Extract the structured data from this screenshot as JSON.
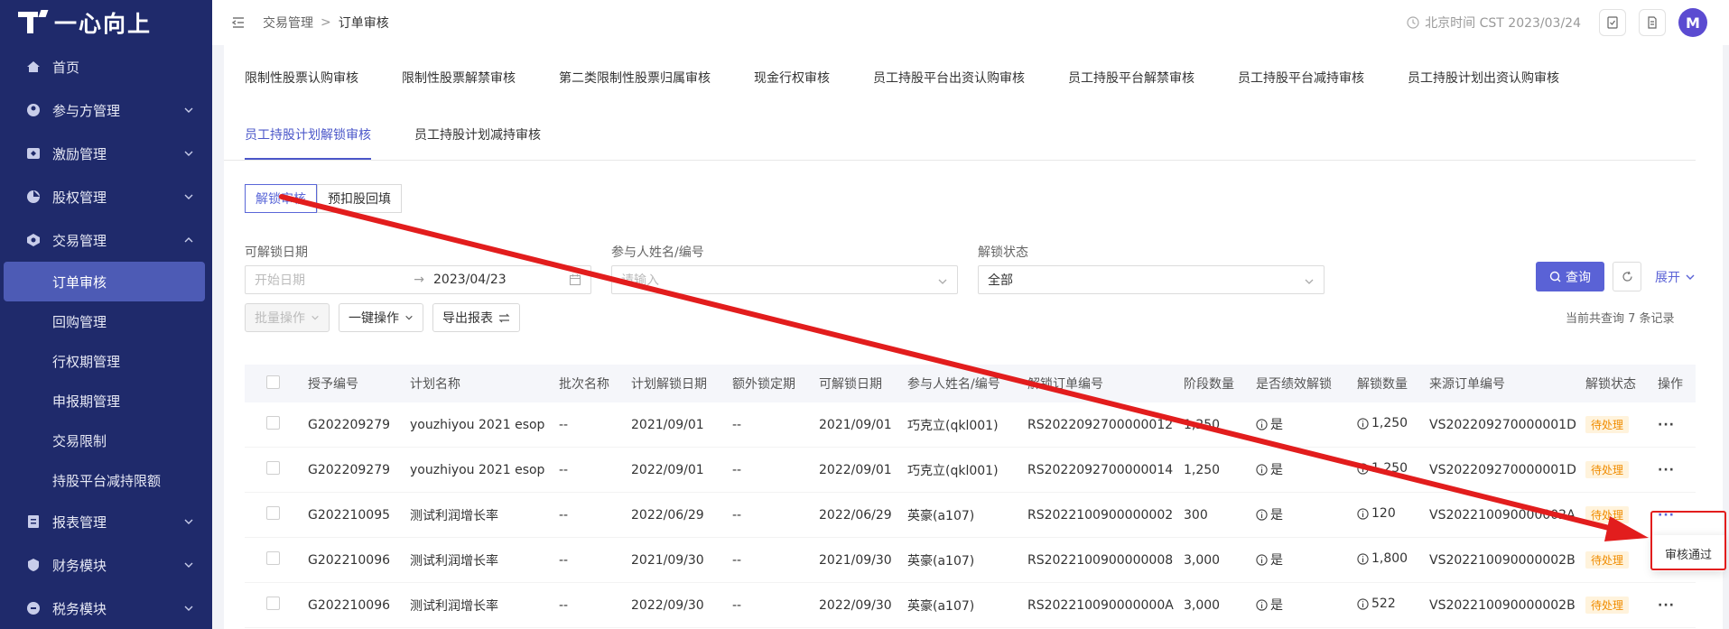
{
  "brand": {
    "name": "一心向上"
  },
  "sidebar": {
    "items": [
      {
        "label": "首页",
        "icon": "home-icon"
      },
      {
        "label": "参与方管理",
        "icon": "participant-icon"
      },
      {
        "label": "激励管理",
        "icon": "incentive-icon"
      },
      {
        "label": "股权管理",
        "icon": "equity-icon"
      },
      {
        "label": "交易管理",
        "icon": "trade-icon"
      }
    ],
    "sub_items": [
      "订单审核",
      "回购管理",
      "行权期管理",
      "申报期管理",
      "交易限制",
      "持股平台减持限额"
    ],
    "bottom_items": [
      {
        "label": "报表管理",
        "icon": "report-icon"
      },
      {
        "label": "财务模块",
        "icon": "finance-icon"
      },
      {
        "label": "税务模块",
        "icon": "tax-icon"
      }
    ]
  },
  "header": {
    "breadcrumb": [
      "交易管理",
      "订单审核"
    ],
    "breadcrumb_sep": ">",
    "clock_text": "北京时间 CST 2023/03/24",
    "avatar_letter": "M"
  },
  "tabs_row1": [
    "限制性股票认购审核",
    "限制性股票解禁审核",
    "第二类限制性股票归属审核",
    "现金行权审核",
    "员工持股平台出资认购审核",
    "员工持股平台解禁审核",
    "员工持股平台减持审核",
    "员工持股计划出资认购审核"
  ],
  "tabs_row2": [
    "员工持股计划解锁审核",
    "员工持股计划减持审核"
  ],
  "segments": [
    "解锁审核",
    "预扣股回填"
  ],
  "filters": {
    "date_label": "可解锁日期",
    "date_start_placeholder": "开始日期",
    "date_arrow": "→",
    "date_end": "2023/04/23",
    "participant_label": "参与人姓名/编号",
    "participant_placeholder": "请输入",
    "status_label": "解锁状态",
    "status_value": "全部",
    "query_label": "查询",
    "expand_label": "展开"
  },
  "actions": {
    "batch": "批量操作",
    "one_click": "一键操作",
    "export": "导出报表",
    "total": "当前共查询 7 条记录"
  },
  "table": {
    "headers": [
      "授予编号",
      "计划名称",
      "批次名称",
      "计划解锁日期",
      "额外锁定期",
      "可解锁日期",
      "参与人姓名/编号",
      "解锁订单编号",
      "阶段数量",
      "是否绩效解锁",
      "解锁数量",
      "来源订单编号",
      "解锁状态",
      "操作"
    ],
    "rows": [
      [
        "G202209279",
        "youzhiyou 2021 esop",
        "--",
        "2021/09/01",
        "--",
        "2021/09/01",
        "巧克立(qkl001)",
        "RS2022092700000012",
        "1,250",
        "是",
        "1,250",
        "VS202209270000001D",
        "待处理",
        "···"
      ],
      [
        "G202209279",
        "youzhiyou 2021 esop",
        "--",
        "2022/09/01",
        "--",
        "2022/09/01",
        "巧克立(qkl001)",
        "RS2022092700000014",
        "1,250",
        "是",
        "1,250",
        "VS202209270000001D",
        "待处理",
        "···"
      ],
      [
        "G202210095",
        "测试利润增长率",
        "--",
        "2022/06/29",
        "--",
        "2022/06/29",
        "英豪(a107)",
        "RS2022100900000002",
        "300",
        "是",
        "120",
        "VS202210090000002A",
        "待处理",
        "···"
      ],
      [
        "G202210096",
        "测试利润增长率",
        "--",
        "2021/09/30",
        "--",
        "2021/09/30",
        "英豪(a107)",
        "RS2022100900000008",
        "3,000",
        "是",
        "1,800",
        "VS202210090000002B",
        "待处理",
        "···"
      ],
      [
        "G202210096",
        "测试利润增长率",
        "--",
        "2022/09/30",
        "--",
        "2022/09/30",
        "英豪(a107)",
        "RS202210090000000A",
        "3,000",
        "是",
        "522",
        "VS202210090000002B",
        "待处理",
        "···"
      ]
    ]
  },
  "dropdown": {
    "item": "审核通过"
  },
  "colors": {
    "sidebar": "#1f2a6b",
    "accent": "#5a62d6",
    "annotation": "#e21d1d",
    "pending": "#f08c00"
  }
}
